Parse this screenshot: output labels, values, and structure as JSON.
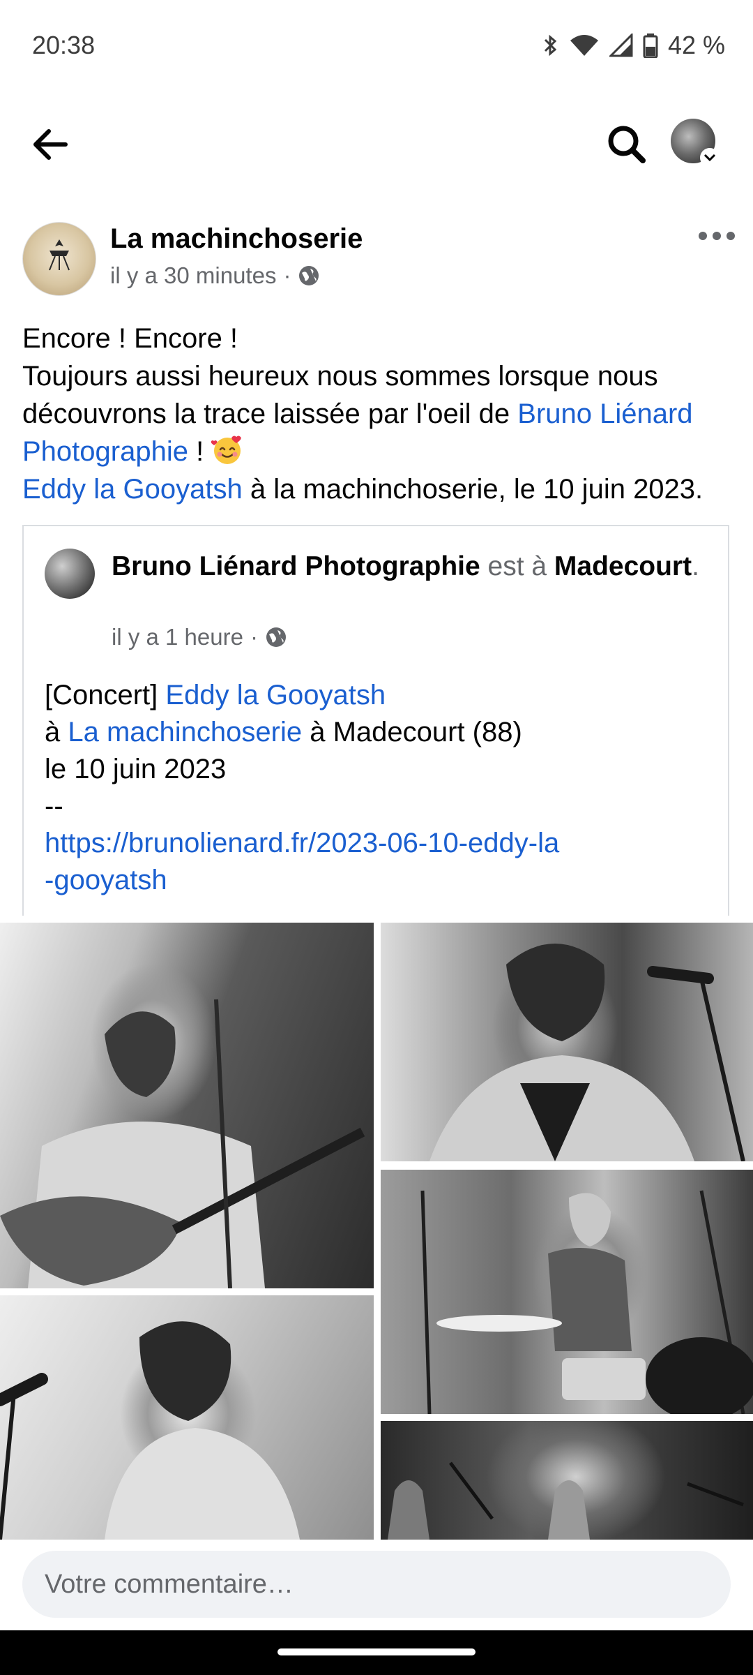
{
  "status_bar": {
    "time": "20:38",
    "battery": "42 %",
    "icons": [
      "bluetooth-icon",
      "wifi-icon",
      "signal-icon",
      "battery-icon"
    ]
  },
  "app_bar": {
    "icons": [
      "back-arrow-icon",
      "search-icon",
      "profile-avatar"
    ]
  },
  "post": {
    "author": "La machinchoserie",
    "time": "il y a 30 minutes",
    "separator": "·",
    "privacy_icon": "globe-icon",
    "text": {
      "line1": "Encore ! Encore !",
      "line2_pre": "Toujours aussi heureux nous sommes lorsque nous découvrons la trace laissée par l'oeil de ",
      "mention1": "Bruno Liénard Photographie",
      "line2_post": " ! ",
      "emoji": "smiling-face-with-hearts",
      "mention2": "Eddy la Gooyatsh",
      "line3_post": " à la machinchoserie, le 10 juin 2023."
    }
  },
  "shared_post": {
    "author": "Bruno Liénard Photographie",
    "checkin_word": " est à ",
    "location": "Madecourt",
    "period": ".",
    "time": "il y a 1 heure",
    "separator": "·",
    "body": {
      "l1_pre": "[Concert] ",
      "l1_link": "Eddy la Gooyatsh",
      "l2_pre": "à ",
      "l2_link": "La machinchoserie",
      "l2_post": " à Madecourt (88)",
      "l3": "le 10 juin 2023",
      "l4": "--",
      "url_part1": "https://brunolienard.fr/2023-06-10-eddy-la",
      "url_part2": "-gooyatsh"
    }
  },
  "photos": [
    {
      "alt": "guitarist-photo"
    },
    {
      "alt": "bassist-photo"
    },
    {
      "alt": "singer-photo"
    },
    {
      "alt": "drummer-photo"
    },
    {
      "alt": "band-photo"
    }
  ],
  "comment": {
    "placeholder": "Votre commentaire…"
  },
  "colors": {
    "link": "#1a5fd0",
    "muted": "#65676b",
    "text": "#050505",
    "input_bg": "#f0f2f5"
  }
}
